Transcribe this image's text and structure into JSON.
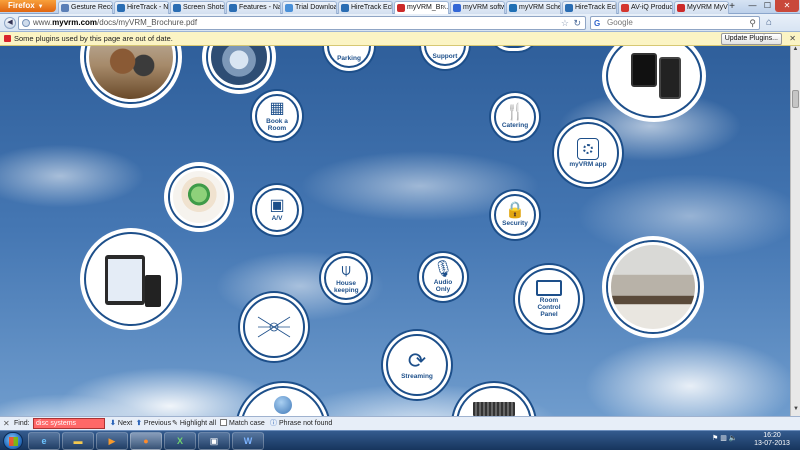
{
  "browser": {
    "app_button": "Firefox",
    "tabs": [
      {
        "label": "Gesture Recog...",
        "fav": "#5b7fb7"
      },
      {
        "label": "HireTrack - N...",
        "fav": "#2a6db3"
      },
      {
        "label": "Screen Shots -...",
        "fav": "#2a6db3"
      },
      {
        "label": "Features - Nav...",
        "fav": "#2a6db3"
      },
      {
        "label": "Trial Downloa...",
        "fav": "#4a90d8"
      },
      {
        "label": "HireTrack Ecli...",
        "fav": "#2a6db3"
      },
      {
        "label": "myVRM_Br...",
        "fav": "#cc2a2a",
        "active": true
      },
      {
        "label": "myVRM softw...",
        "fav": "#3367d6"
      },
      {
        "label": "myVRM Sche...",
        "fav": "#1f6fb4"
      },
      {
        "label": "HireTrack Ecli...",
        "fav": "#2a6db3"
      },
      {
        "label": "AV-iQ Produc...",
        "fav": "#d4362f"
      },
      {
        "label": "MyVRM MyVR...",
        "fav": "#cc2a2a"
      }
    ],
    "url_prefix": "www.",
    "url_domain": "myvrm.com",
    "url_path": "/docs/myVRM_Brochure.pdf",
    "search_placeholder": "Google",
    "plugin_message": "Some plugins used by this page are out of date.",
    "plugin_button": "Update Plugins..."
  },
  "brochure": {
    "bubbles": {
      "parking": "Parking",
      "support": "Support",
      "book_room": "Book a Room",
      "catering": "Catering",
      "myvrm_app": "myVRM app",
      "av": "A/V",
      "security": "Security",
      "housekeeping": "House keeping",
      "audio_only": "Audio Only",
      "room_control": "Room Control Panel",
      "streaming": "Streaming"
    }
  },
  "findbar": {
    "label": "Find:",
    "query": "disc systems",
    "next": "Next",
    "previous": "Previous",
    "highlight": "Highlight all",
    "match_case": "Match case",
    "status": "Phrase not found"
  },
  "taskbar": {
    "time": "16:20",
    "date": "13-07-2013"
  }
}
